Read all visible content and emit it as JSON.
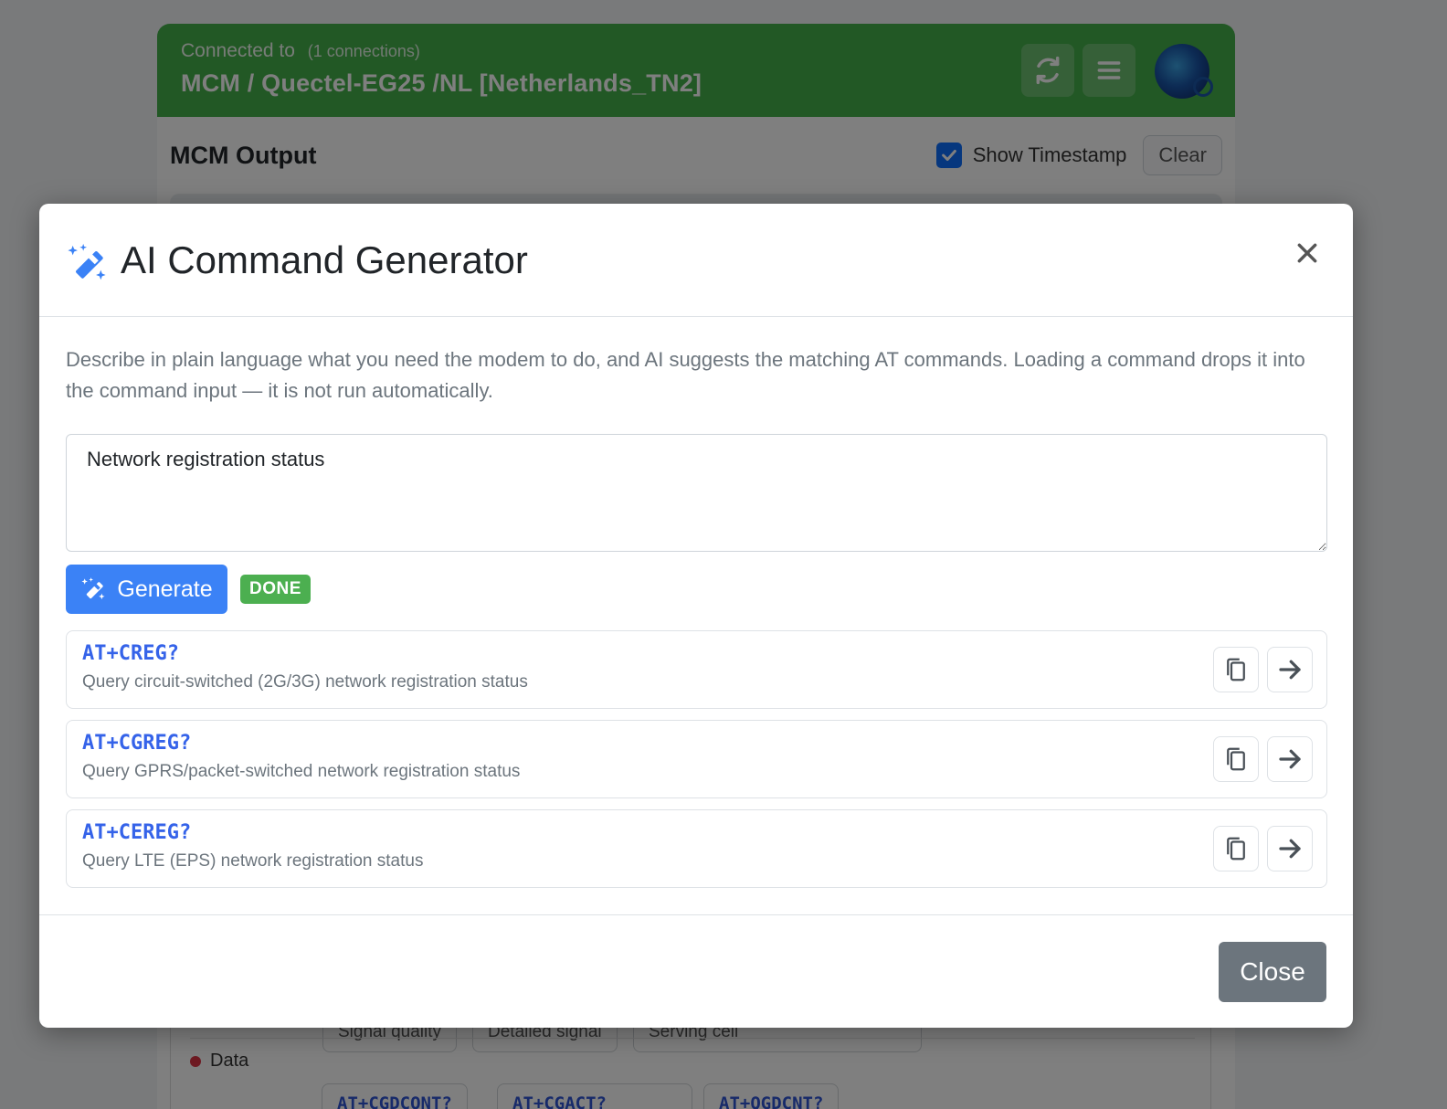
{
  "background": {
    "header": {
      "connected_label": "Connected to",
      "connections": "(1 connections)",
      "device": "MCM / Quectel-EG25 /NL [Netherlands_TN2]"
    },
    "output": {
      "title": "MCM Output",
      "show_timestamp": "Show Timestamp",
      "clear": "Clear"
    },
    "signal_chips": [
      "Signal quality",
      "Detailed signal",
      "Serving cell"
    ],
    "data_label": "Data",
    "data_chips": [
      "AT+CGDCONT?",
      "AT+CGACT?",
      "AT+QGDCNT?"
    ]
  },
  "modal": {
    "title": "AI Command Generator",
    "description": "Describe in plain language what you need the modem to do, and AI suggests the matching AT commands. Loading a command drops it into the command input — it is not run automatically.",
    "prompt_value": "Network registration status",
    "generate_label": "Generate",
    "status_badge": "DONE",
    "results": [
      {
        "command": "AT+CREG?",
        "description": "Query circuit-switched (2G/3G) network registration status"
      },
      {
        "command": "AT+CGREG?",
        "description": "Query GPRS/packet-switched network registration status"
      },
      {
        "command": "AT+CEREG?",
        "description": "Query LTE (EPS) network registration status"
      }
    ],
    "close_label": "Close"
  },
  "colors": {
    "header_green": "#44b04a",
    "primary_blue": "#3b82f6",
    "command_blue": "#3563e9",
    "done_green": "#4caf50",
    "secondary_gray": "#6c757d"
  },
  "icons": [
    "sync-icon",
    "menu-icon",
    "wand-sparkles-icon",
    "close-icon",
    "copy-icon",
    "arrow-right-icon",
    "checkbox-checked-icon"
  ]
}
